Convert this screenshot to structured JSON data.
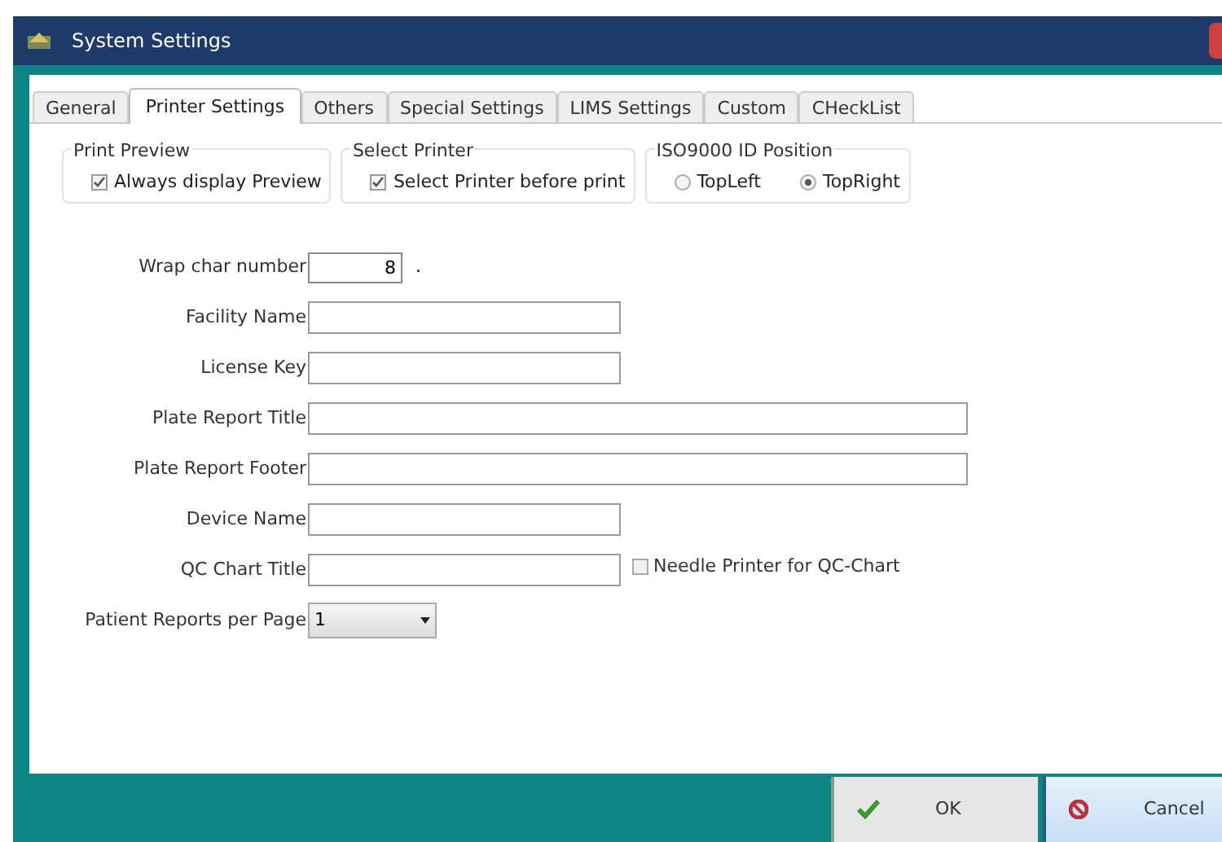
{
  "window": {
    "title": "System Settings"
  },
  "tabs": [
    {
      "label": "General",
      "selected": false
    },
    {
      "label": "Printer Settings",
      "selected": true
    },
    {
      "label": "Others",
      "selected": false
    },
    {
      "label": "Special Settings",
      "selected": false
    },
    {
      "label": "LIMS Settings",
      "selected": false
    },
    {
      "label": "Custom",
      "selected": false
    },
    {
      "label": "CHeckList",
      "selected": false
    }
  ],
  "groups": [
    {
      "title": "Print Preview",
      "kind": "checkbox",
      "options": [
        {
          "label": "Always display Preview",
          "checked": true
        }
      ]
    },
    {
      "title": "Select Printer",
      "kind": "checkbox",
      "options": [
        {
          "label": "Select Printer before print",
          "checked": true
        }
      ]
    },
    {
      "title": "ISO9000 ID Position",
      "kind": "radio",
      "options": [
        {
          "label": "TopLeft",
          "selected": false
        },
        {
          "label": "TopRight",
          "selected": true
        }
      ]
    }
  ],
  "fields": [
    {
      "label": "Wrap char number",
      "kind": "number",
      "value": "8",
      "suffix": "."
    },
    {
      "label": "Facility Name",
      "kind": "text"
    },
    {
      "label": "License Key",
      "kind": "text"
    },
    {
      "label": "Plate Report Title",
      "kind": "wide_text"
    },
    {
      "label": "Plate Report Footer",
      "kind": "wide_text"
    },
    {
      "label": "Device Name",
      "kind": "text"
    },
    {
      "label": "QC Chart Title",
      "kind": "text",
      "checkbox": {
        "label": "Needle Printer for QC-Chart",
        "checked": false
      }
    },
    {
      "label": "Patient Reports per Page",
      "kind": "dropdown",
      "value": "1"
    }
  ],
  "buttons": [
    {
      "label": "OK",
      "kind": "ok"
    },
    {
      "label": "Cancel",
      "kind": "cancel"
    }
  ]
}
